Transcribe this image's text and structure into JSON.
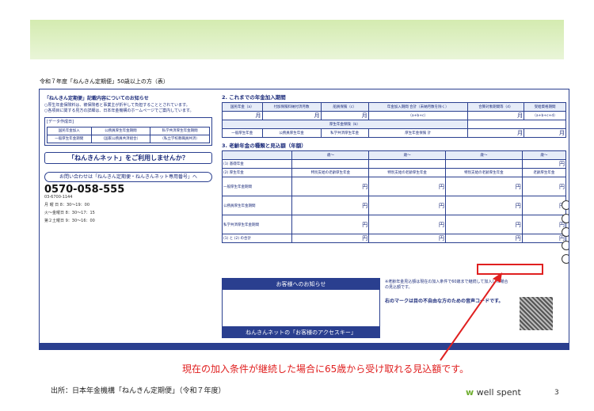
{
  "document_title": "令和７年度「ねんきん定期便」50歳以上の方（表）",
  "left_panel": {
    "heading": "「ねんきん定期便」記載内容についてのお知らせ",
    "notes": [
      "○厚生年金保険料は、被保険者と事業主が折半して負担することとされています。",
      "○各項目に関する見方の詳細は、日本年金機構のホームページでご案内しています。"
    ],
    "data_label": "[データ作成日]",
    "table": [
      [
        "国民年金加入",
        "公務員厚生年金期間",
        "私学共済厚生年金期間"
      ],
      [
        "一般厚生年金期間",
        "（国家公務員共済組合）",
        "（私立学校教職員共済）"
      ]
    ],
    "net_title": "「ねんきんネット」をご利用しませんか？",
    "inquiry": "お問い合わせは「ねんきん定期便・ねんきんネット専用番号」へ",
    "phone": "0570-058-555",
    "phone2": "03-6700-1144",
    "hours": [
      "月 曜 日 8：30～19：00",
      "火～金曜日 8：30～17：15",
      "第２土曜日 9：30～16：00"
    ]
  },
  "right_panel": {
    "sec2_title": "2. これまでの年金加入期間",
    "sec2_cols": [
      "国民年金（a）",
      "付加保険料納付済月数",
      "船員保険（c）",
      "年金加入期間 合計（未納月数を除く）",
      "合算対象期間等（d）",
      "受給資格期間"
    ],
    "sec2_formula": [
      "（a+b+c）",
      "（a+b+c+d）"
    ],
    "month_unit": "月",
    "kosei": "厚生年金保険（b）",
    "kosei_cols": [
      "一般厚生年金",
      "公務員厚生年金",
      "私学共済厚生年金",
      "厚生年金保険 計"
    ],
    "sec3_title": "3. 老齢年金の種類と見込額（年額）",
    "sec3_rows": [
      "(1) 基礎年金",
      "(2) 厚生年金",
      "一般厚生年金期間",
      "公務員厚生年金期間",
      "私学共済厚生年金期間",
      "(1) と (2) の合計"
    ],
    "sec3_cols": [
      "特別支給の老齢厚生年金",
      "特別支給の老齢厚生年金",
      "特別支給の老齢厚生年金",
      "老齢厚生年金"
    ],
    "age_label": "歳～",
    "yen": "円",
    "notice_title": "お客様へのお知らせ",
    "netbar": "ねんきんネットの「お客様のアクセスキー」",
    "note_right": "※老齢年金見込額は現在の加入条件で60歳まで継続して加入した場合の見込額です。",
    "voice_note": "右のマークは目の不自由な方のための音声コードです。"
  },
  "caption": "現在の加入条件が継続した場合に65歳から受け取れる見込額です。",
  "source": "出所：日本年金機構「ねんきん定期便」（令和７年度）",
  "logo": {
    "text": "well spent",
    "mark": "w"
  },
  "page_number": "3",
  "colors": {
    "accent_red": "#e02020",
    "navy": "#2a3f8f",
    "green_band": "#d4ebb0"
  }
}
